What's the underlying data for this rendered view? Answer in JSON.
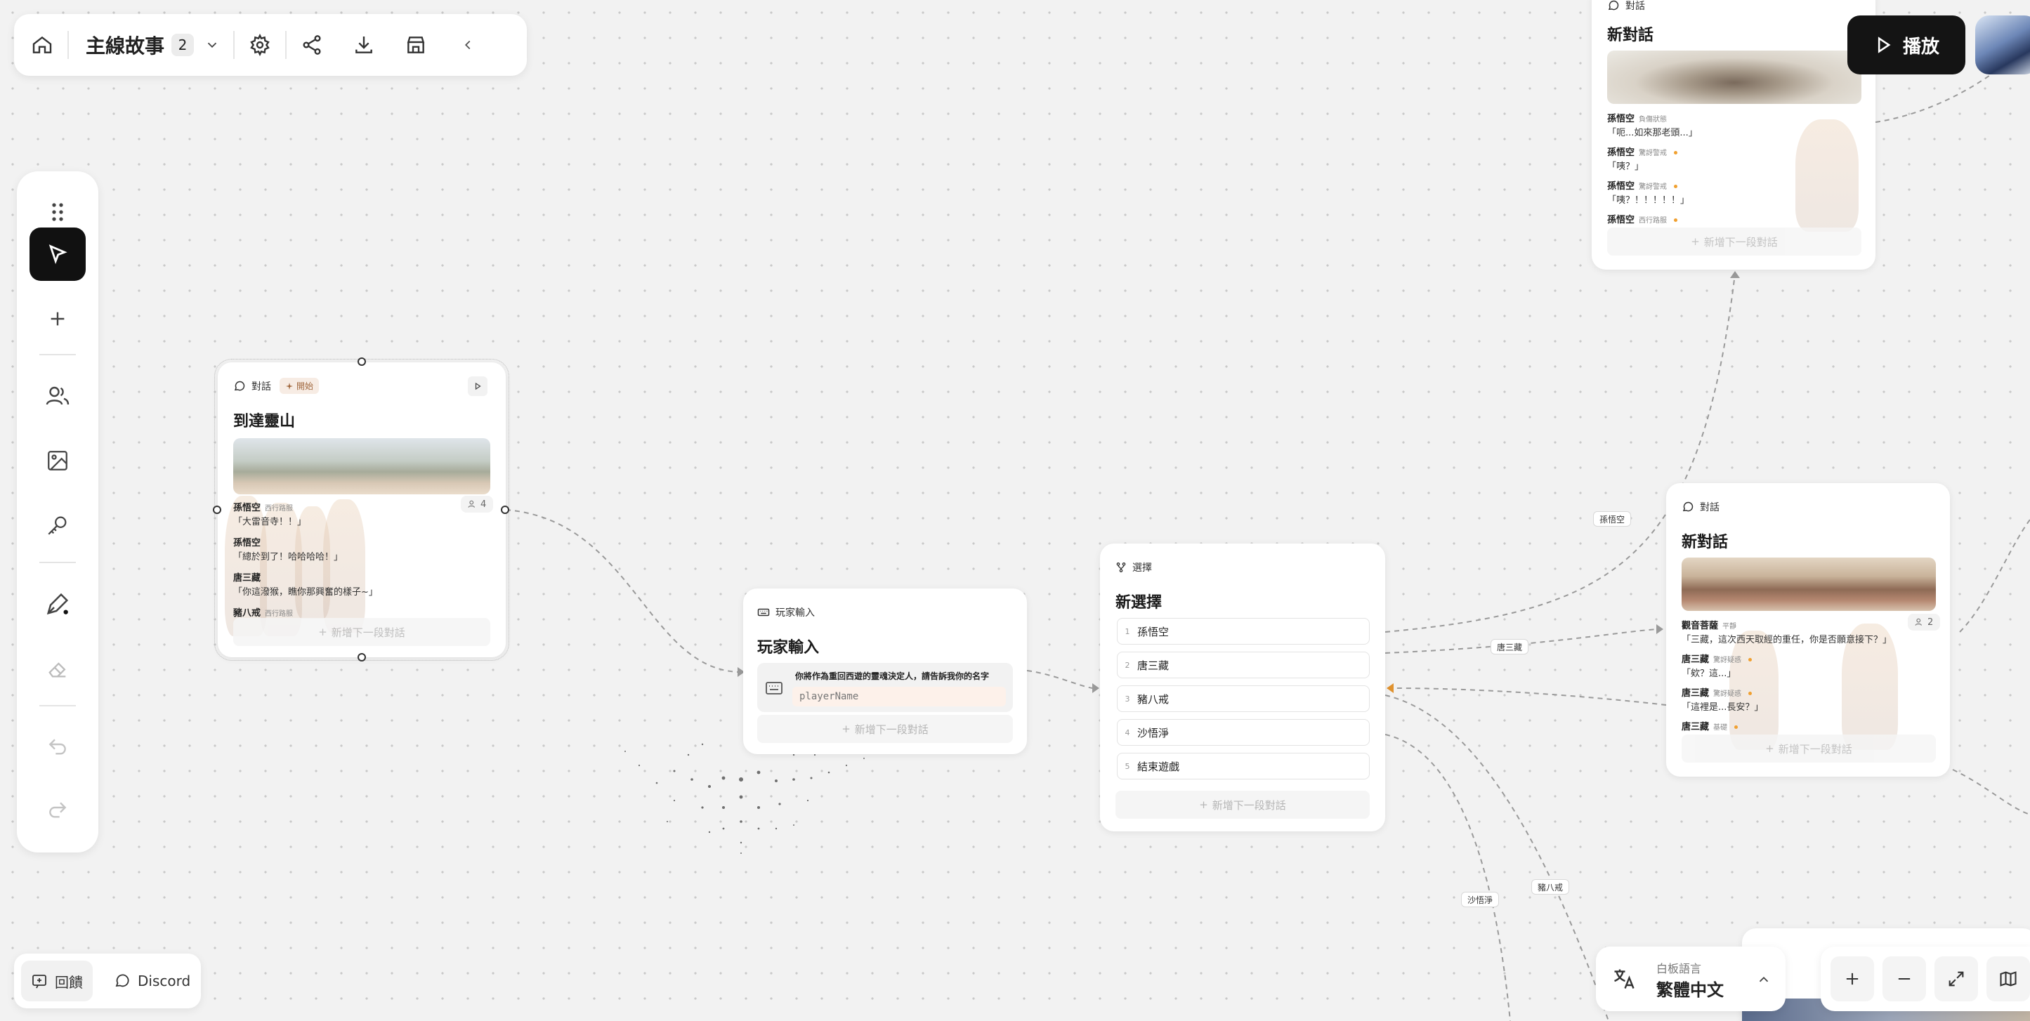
{
  "toolbar": {
    "story_title": "主線故事",
    "story_count": "2"
  },
  "play_button": {
    "label": "播放"
  },
  "nodes": {
    "arrive": {
      "type_label": "對話",
      "start_badge": "開始",
      "title": "到達靈山",
      "char_count": "4",
      "lines": [
        {
          "speaker": "孫悟空",
          "tag": "西行路服",
          "text": "「大雷音寺！！」"
        },
        {
          "speaker": "孫悟空",
          "tag": "",
          "text": "「總於到了！哈哈哈哈！」"
        },
        {
          "speaker": "唐三藏",
          "tag": "",
          "text": "「你這潑猴，瞧你那興奮的樣子~」"
        },
        {
          "speaker": "豬八戒",
          "tag": "西行路服",
          "text": ""
        }
      ],
      "add_label": "新增下一段對話"
    },
    "player_input": {
      "type_label": "玩家輸入",
      "title": "玩家輸入",
      "prompt": "你將作為重回西遊的靈魂決定人，請告訴我你的名字",
      "variable": "playerName",
      "add_label": "新增下一段對話"
    },
    "choice": {
      "type_label": "選擇",
      "title": "新選擇",
      "options": [
        {
          "num": "1",
          "label": "孫悟空"
        },
        {
          "num": "2",
          "label": "唐三藏"
        },
        {
          "num": "3",
          "label": "豬八戒"
        },
        {
          "num": "4",
          "label": "沙悟淨"
        },
        {
          "num": "5",
          "label": "結束遊戲"
        }
      ],
      "add_label": "新增下一段對話"
    },
    "dialogue_top": {
      "type_label": "對話",
      "title": "新對話",
      "lines": [
        {
          "speaker": "孫悟空",
          "tag": "負傷狀態",
          "text": "「呃...如來那老頭...」"
        },
        {
          "speaker": "孫悟空",
          "tag": "驚訝警戒",
          "text": "「咦？」"
        },
        {
          "speaker": "孫悟空",
          "tag": "驚訝警戒",
          "text": "「咦？！！！！！」"
        },
        {
          "speaker": "孫悟空",
          "tag": "西行路服",
          "text": ""
        }
      ],
      "add_label": "新增下一段對話"
    },
    "dialogue_mid": {
      "type_label": "對話",
      "title": "新對話",
      "char_count": "2",
      "lines": [
        {
          "speaker": "觀音菩薩",
          "tag": "平靜",
          "text": "「三藏，這次西天取經的重任，你是否願意接下？」"
        },
        {
          "speaker": "唐三藏",
          "tag": "驚訝疑惑",
          "text": "「欸？這...」"
        },
        {
          "speaker": "唐三藏",
          "tag": "驚訝疑惑",
          "text": "「這裡是...長安？」"
        },
        {
          "speaker": "唐三藏",
          "tag": "基礎",
          "text": ""
        }
      ],
      "add_label": "新增下一段對話"
    }
  },
  "edge_labels": {
    "sun": "孫悟空",
    "tang": "唐三藏",
    "zhu": "豬八戒",
    "sha": "沙悟淨"
  },
  "bottom": {
    "feedback_label": "回饋",
    "discord_label": "Discord",
    "language_caption": "白板語言",
    "language_value": "繁體中文"
  },
  "colors": {
    "canvas": "#f2f2f2",
    "accent_dark": "#141414",
    "edge_orange": "#e0922e",
    "input_highlight": "#fdf1ea"
  },
  "icons": [
    "home-icon",
    "chevron-down-icon",
    "gear-icon",
    "share-icon",
    "download-icon",
    "store-icon",
    "chevron-left-icon",
    "grip-icon",
    "pointer-icon",
    "plus-icon",
    "people-icon",
    "image-icon",
    "key-icon",
    "pen-icon",
    "eraser-icon",
    "undo-icon",
    "redo-icon",
    "play-icon",
    "chat-icon",
    "sparkle-icon",
    "keyboard-icon",
    "branch-icon",
    "translate-icon",
    "chevron-up-icon",
    "minus-icon",
    "expand-icon",
    "map-icon",
    "feedback-icon"
  ]
}
